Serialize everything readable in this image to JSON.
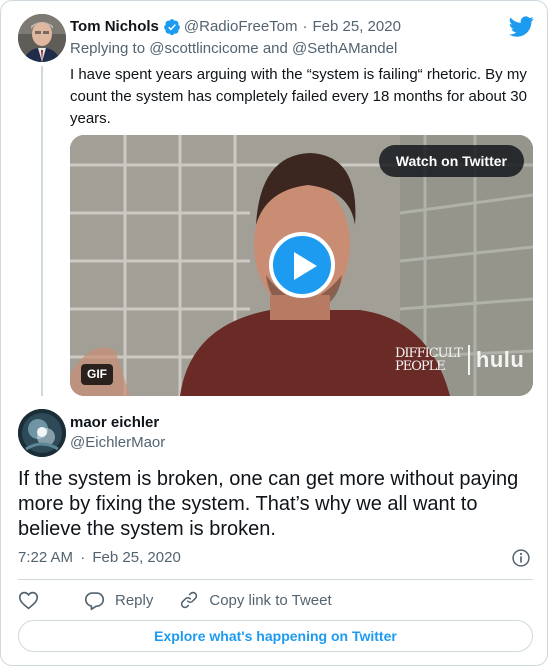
{
  "parent_tweet": {
    "author_name": "Tom Nichols",
    "handle": "@RadioFreeTom",
    "separator": "·",
    "date": "Feb 25, 2020",
    "reply_prefix": "Replying to",
    "reply_to_1": "@scottlincicome",
    "reply_and": "and",
    "reply_to_2": "@SethAMandel",
    "text": "I have spent years arguing with the “system is failing“ rhetoric. By my count the system has completely failed every 18 months for about 30 years.",
    "media": {
      "watch_label": "Watch on Twitter",
      "gif_badge": "GIF",
      "watermark_show_line1": "Difficult",
      "watermark_show_line2": "People",
      "watermark_brand": "hulu"
    }
  },
  "main_tweet": {
    "author_name": "maor eichler",
    "handle": "@EichlerMaor",
    "text": "If the system is broken, one can get more without paying more by fixing the system. That’s why we all want to believe the system is broken.",
    "time": "7:22 AM",
    "separator": "·",
    "date": "Feb 25, 2020"
  },
  "actions": {
    "reply_label": "Reply",
    "copy_link_label": "Copy link to Tweet"
  },
  "footer": {
    "explore_label": "Explore what's happening on Twitter"
  },
  "icons": {
    "brand": "twitter-bird-icon",
    "verified": "verified-badge-icon",
    "play": "play-icon",
    "info": "info-icon",
    "like": "heart-icon",
    "reply": "speech-bubble-icon",
    "link": "link-icon"
  },
  "colors": {
    "accent": "#1d9bf0",
    "text": "#0f1419",
    "muted": "#536471",
    "border": "#cfd9de"
  }
}
